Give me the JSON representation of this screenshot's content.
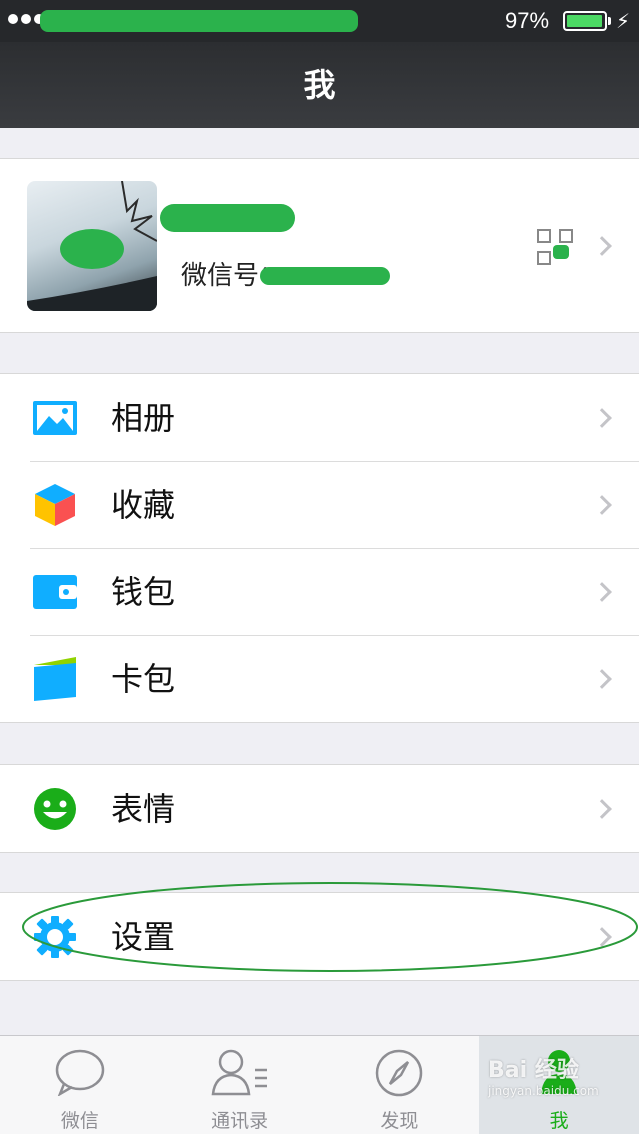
{
  "status_bar": {
    "battery": "97%",
    "battery_level": 0.97
  },
  "nav": {
    "title": "我"
  },
  "profile": {
    "wechat_id_label": "微信号："
  },
  "menu_groups": [
    [
      {
        "label": "相册",
        "icon": "photo-album-icon"
      },
      {
        "label": "收藏",
        "icon": "favorites-cube-icon"
      },
      {
        "label": "钱包",
        "icon": "wallet-icon"
      },
      {
        "label": "卡包",
        "icon": "card-pack-icon"
      }
    ],
    [
      {
        "label": "表情",
        "icon": "smiley-icon"
      }
    ],
    [
      {
        "label": "设置",
        "icon": "gear-icon"
      }
    ]
  ],
  "tabs": [
    {
      "label": "微信",
      "icon": "chat-bubble-icon",
      "active": false
    },
    {
      "label": "通讯录",
      "icon": "contacts-icon",
      "active": false
    },
    {
      "label": "发现",
      "icon": "compass-icon",
      "active": false
    },
    {
      "label": "我",
      "icon": "person-icon",
      "active": true
    }
  ],
  "colors": {
    "brand_green": "#1aad19",
    "nav_bg": "#2c2e31",
    "page_bg": "#efeff4",
    "icon_blue": "#10aeff"
  },
  "watermark": {
    "main": "Bai 经验",
    "sub": "jingyan.baidu.com"
  }
}
